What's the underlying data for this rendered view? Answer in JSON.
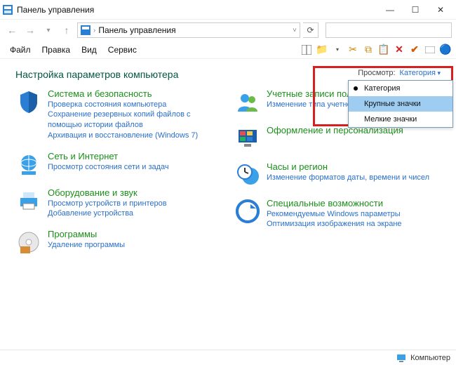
{
  "window": {
    "title": "Панель управления"
  },
  "address": {
    "text": "Панель управления"
  },
  "menu": {
    "file": "Файл",
    "edit": "Правка",
    "view": "Вид",
    "tools": "Сервис"
  },
  "heading": "Настройка параметров компьютера",
  "view": {
    "label": "Просмотр:",
    "selected": "Категория",
    "options": {
      "category": "Категория",
      "large": "Крупные значки",
      "small": "Мелкие значки"
    }
  },
  "left": {
    "security": {
      "name": "Система и безопасность",
      "l1": "Проверка состояния компьютера",
      "l2": "Сохранение резервных копий файлов с помощью истории файлов",
      "l3": "Архивация и восстановление (Windows 7)"
    },
    "network": {
      "name": "Сеть и Интернет",
      "l1": "Просмотр состояния сети и задач"
    },
    "hardware": {
      "name": "Оборудование и звук",
      "l1": "Просмотр устройств и принтеров",
      "l2": "Добавление устройства"
    },
    "programs": {
      "name": "Программы",
      "l1": "Удаление программы"
    }
  },
  "right": {
    "accounts": {
      "name": "Учетные записи поль",
      "l1": "Изменение типа учетной з"
    },
    "appearance": {
      "name": "Оформление и персонализация"
    },
    "clock": {
      "name": "Часы и регион",
      "l1": "Изменение форматов даты, времени и чисел"
    },
    "ease": {
      "name": "Специальные возможности",
      "l1": "Рекомендуемые Windows параметры",
      "l2": "Оптимизация изображения на экране"
    }
  },
  "status": {
    "computer": "Компьютер"
  }
}
